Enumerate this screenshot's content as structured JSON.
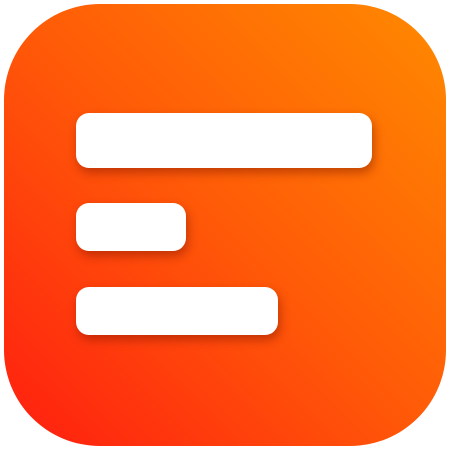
{
  "app_icon": {
    "name": "list-app-icon",
    "colors": {
      "gradient_top_right": "#ff8a00",
      "gradient_bottom_left": "#ff1e10",
      "bar_fill": "#ffffff"
    },
    "bars": [
      {
        "name": "long-bar",
        "relative_length": 1.0
      },
      {
        "name": "short-bar",
        "relative_length": 0.37
      },
      {
        "name": "medium-bar",
        "relative_length": 0.68
      }
    ]
  }
}
